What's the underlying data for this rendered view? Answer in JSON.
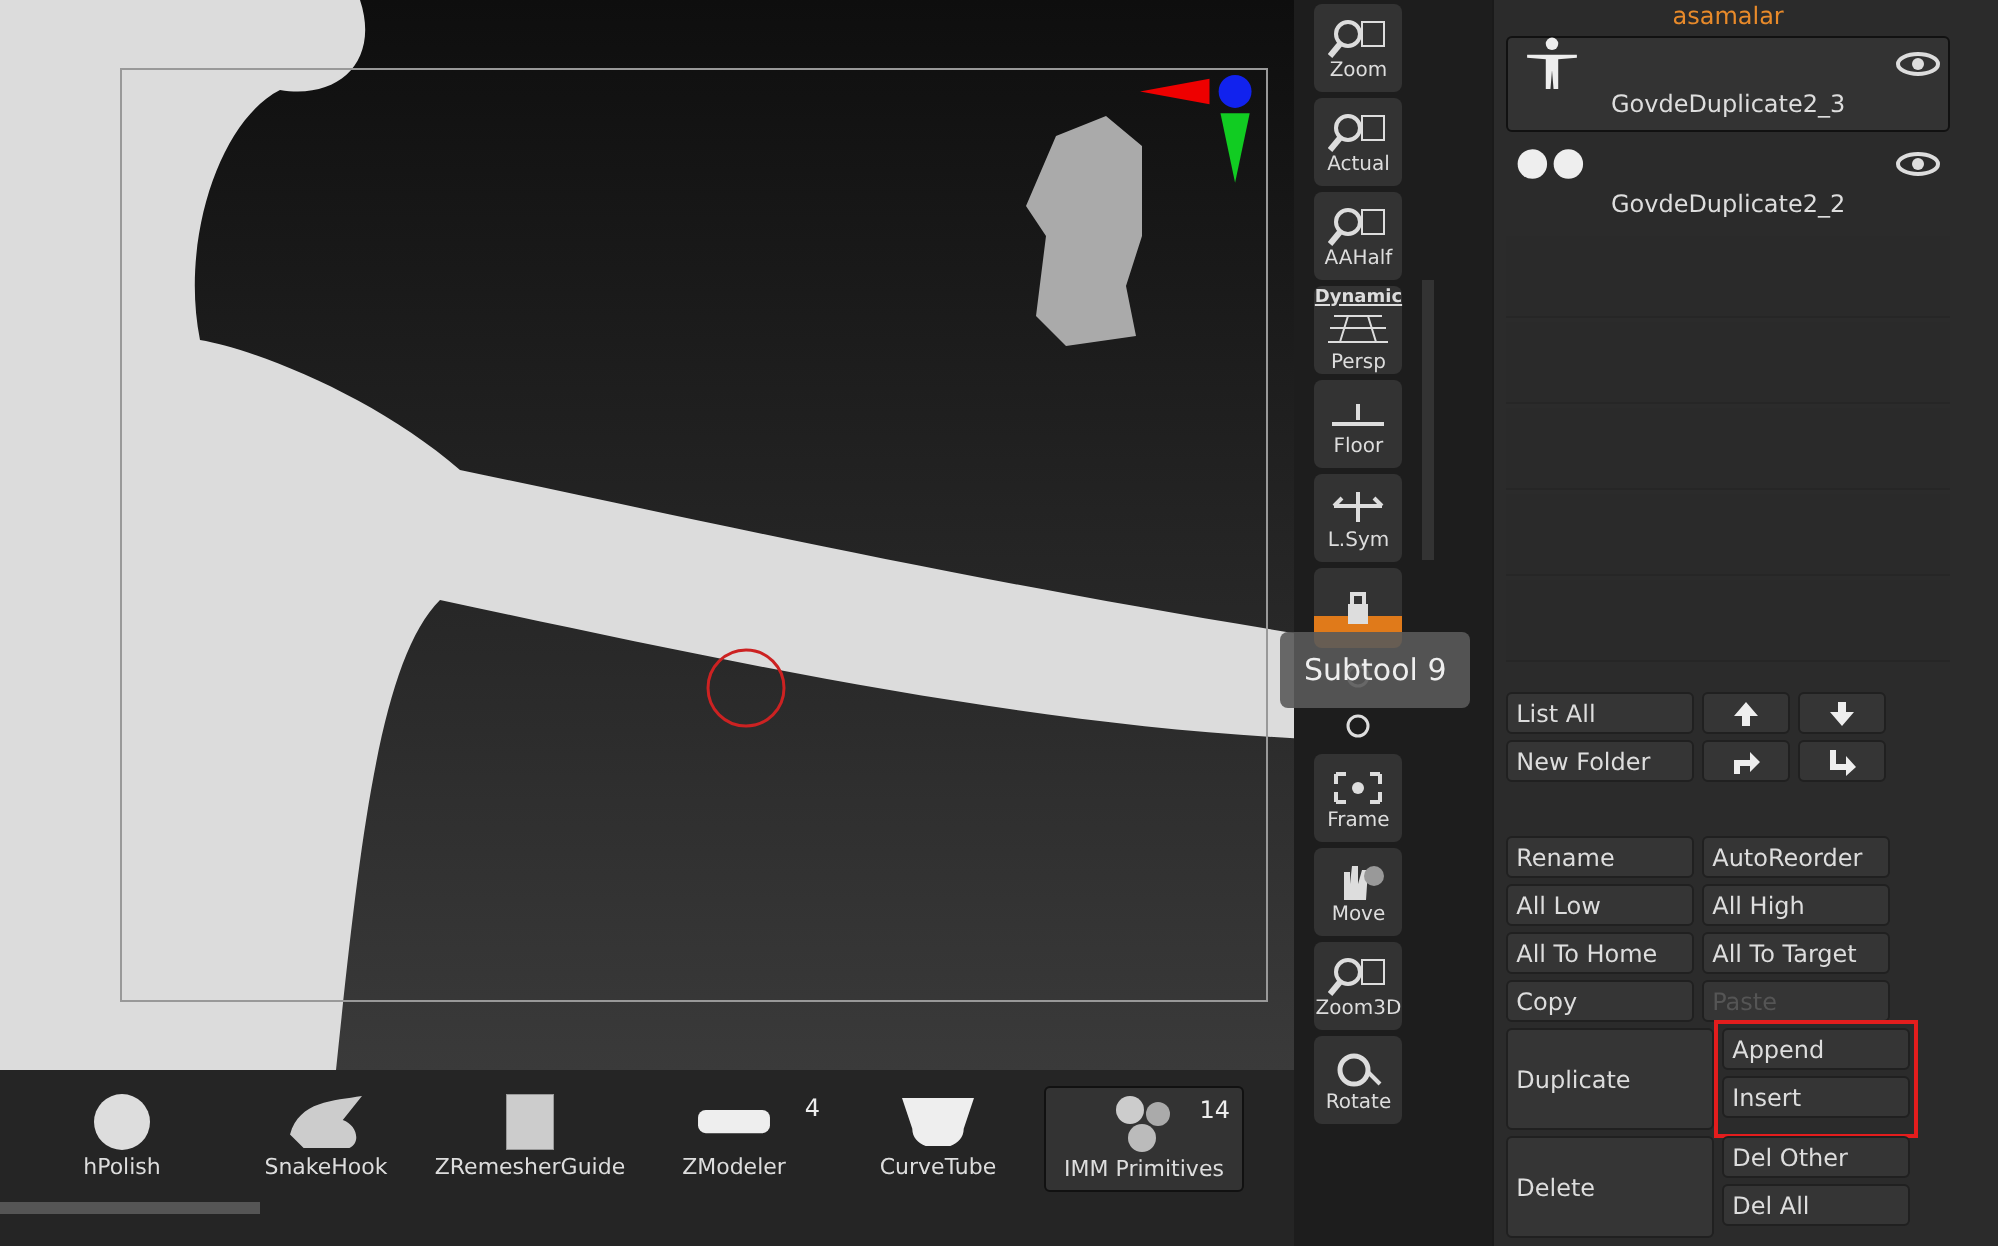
{
  "viewport": {
    "tooltip": "Subtool 9"
  },
  "toolbar_buttons": [
    {
      "label": "Zoom",
      "kind": "zoom"
    },
    {
      "label": "Actual",
      "kind": "zoom"
    },
    {
      "label": "AAHalf",
      "kind": "zoom"
    },
    {
      "label": "Persp",
      "kind": "persp",
      "caption": "Dynamic"
    },
    {
      "label": "Floor",
      "kind": "floor"
    },
    {
      "label": "L.Sym",
      "kind": "sym"
    },
    {
      "kind": "lock",
      "on": true
    },
    {
      "kind": "axis-y"
    },
    {
      "kind": "axis-z"
    },
    {
      "label": "Frame",
      "kind": "frame"
    },
    {
      "label": "Move",
      "kind": "move"
    },
    {
      "label": "Zoom3D",
      "kind": "zoom3d"
    },
    {
      "label": "Rotate",
      "kind": "rotate"
    }
  ],
  "subtool_panel": {
    "folder": "asamalar",
    "subtools": [
      {
        "name": "GovdeDuplicate2_3",
        "selected": true,
        "kind": "figure"
      },
      {
        "name": "GovdeDuplicate2_2",
        "selected": false,
        "kind": "spheres"
      }
    ],
    "top_rows": [
      [
        {
          "label": "List All",
          "kind": "text"
        },
        {
          "kind": "up"
        },
        {
          "kind": "down"
        }
      ],
      [
        {
          "label": "New Folder",
          "kind": "text"
        },
        {
          "kind": "turn-right"
        },
        {
          "kind": "turn-down"
        }
      ]
    ],
    "rows": [
      [
        {
          "label": "Rename",
          "disabled": false
        },
        {
          "label": "AutoReorder",
          "disabled": false
        }
      ],
      [
        {
          "label": "All Low",
          "disabled": false
        },
        {
          "label": "All High",
          "disabled": false
        }
      ],
      [
        {
          "label": "All To Home",
          "disabled": false
        },
        {
          "label": "All To Target",
          "disabled": false
        }
      ],
      [
        {
          "label": "Copy",
          "disabled": false
        },
        {
          "label": "Paste",
          "disabled": true
        }
      ]
    ],
    "groups": [
      {
        "label": "Duplicate",
        "highlighted": true,
        "buttons": [
          "Append",
          "Insert"
        ]
      },
      {
        "label": "Delete",
        "highlighted": false,
        "buttons": [
          "Del Other",
          "Del All"
        ]
      }
    ]
  },
  "brushes": [
    {
      "name": "hPolish",
      "selected": false,
      "kind": "blob"
    },
    {
      "name": "SnakeHook",
      "selected": false,
      "kind": "hook"
    },
    {
      "name": "ZRemesherGuide",
      "selected": false,
      "kind": "cube"
    },
    {
      "name": "ZModeler",
      "count": "4",
      "selected": false,
      "kind": "bar"
    },
    {
      "name": "CurveTube",
      "selected": false,
      "kind": "tube"
    },
    {
      "name": "IMM Primitives",
      "count": "14",
      "selected": true,
      "kind": "prims"
    }
  ]
}
